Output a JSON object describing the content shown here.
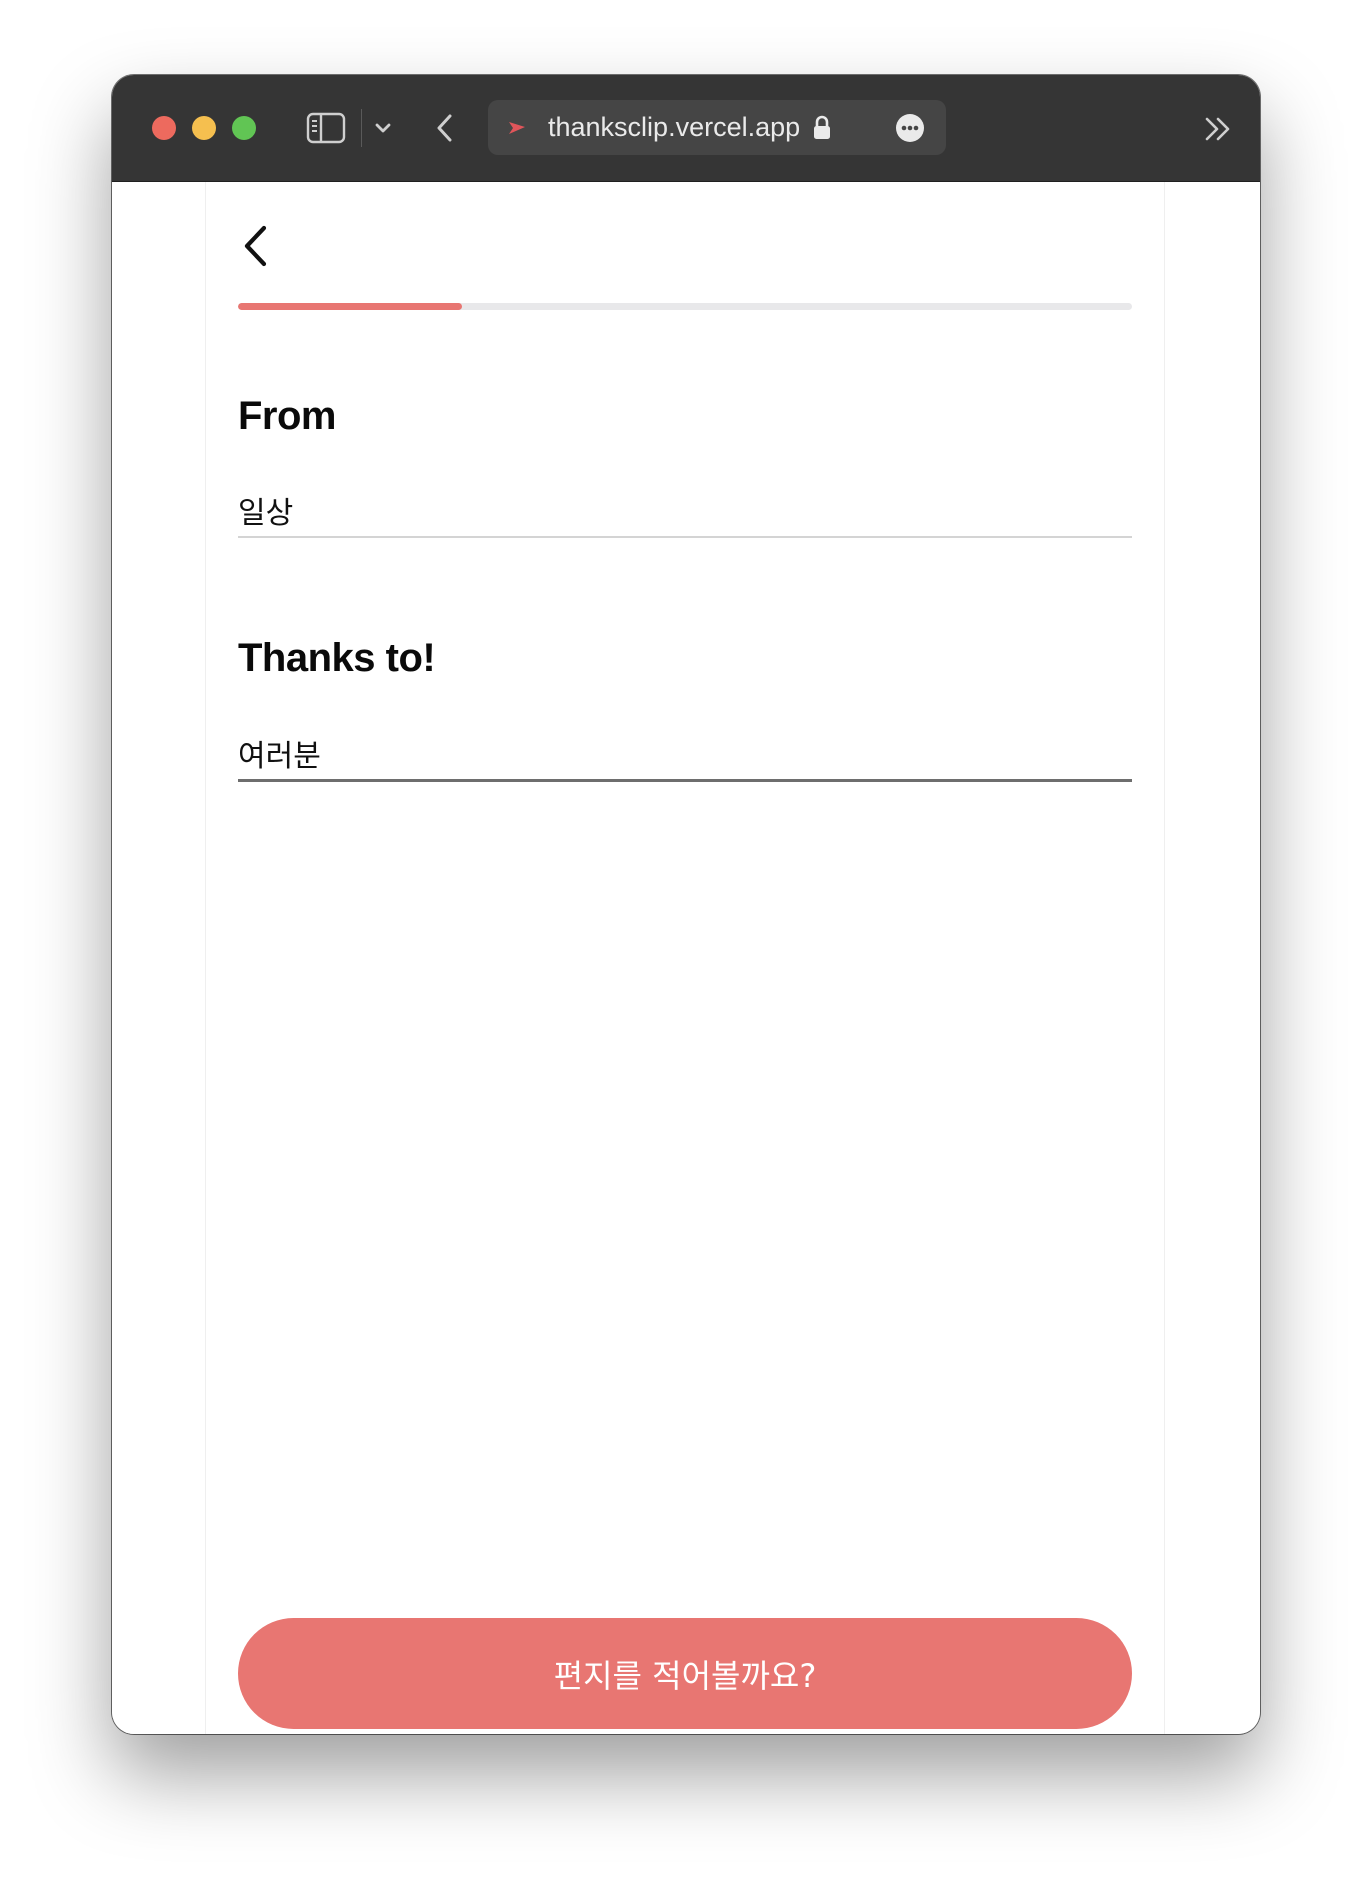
{
  "browser": {
    "url": "thanksclip.vercel.app",
    "icons": {
      "sidebar": "sidebar-icon",
      "dropdown": "chevron-down-icon",
      "back": "chevron-left-icon",
      "favicon": "paper-plane-icon",
      "lock": "lock-icon",
      "page_menu": "ellipsis-circle-icon",
      "more_tabs": "double-chevron-right-icon"
    }
  },
  "page": {
    "back_icon": "chevron-left-icon",
    "progress": 0.25,
    "from": {
      "label": "From",
      "value": "일상"
    },
    "to": {
      "label": "Thanks to!",
      "value": "여러분"
    },
    "cta_label": "편지를 적어볼까요?"
  },
  "colors": {
    "accent": "#e87672",
    "titlebar": "#353535",
    "urlbar": "#454545",
    "track": "#e8e8ea"
  }
}
